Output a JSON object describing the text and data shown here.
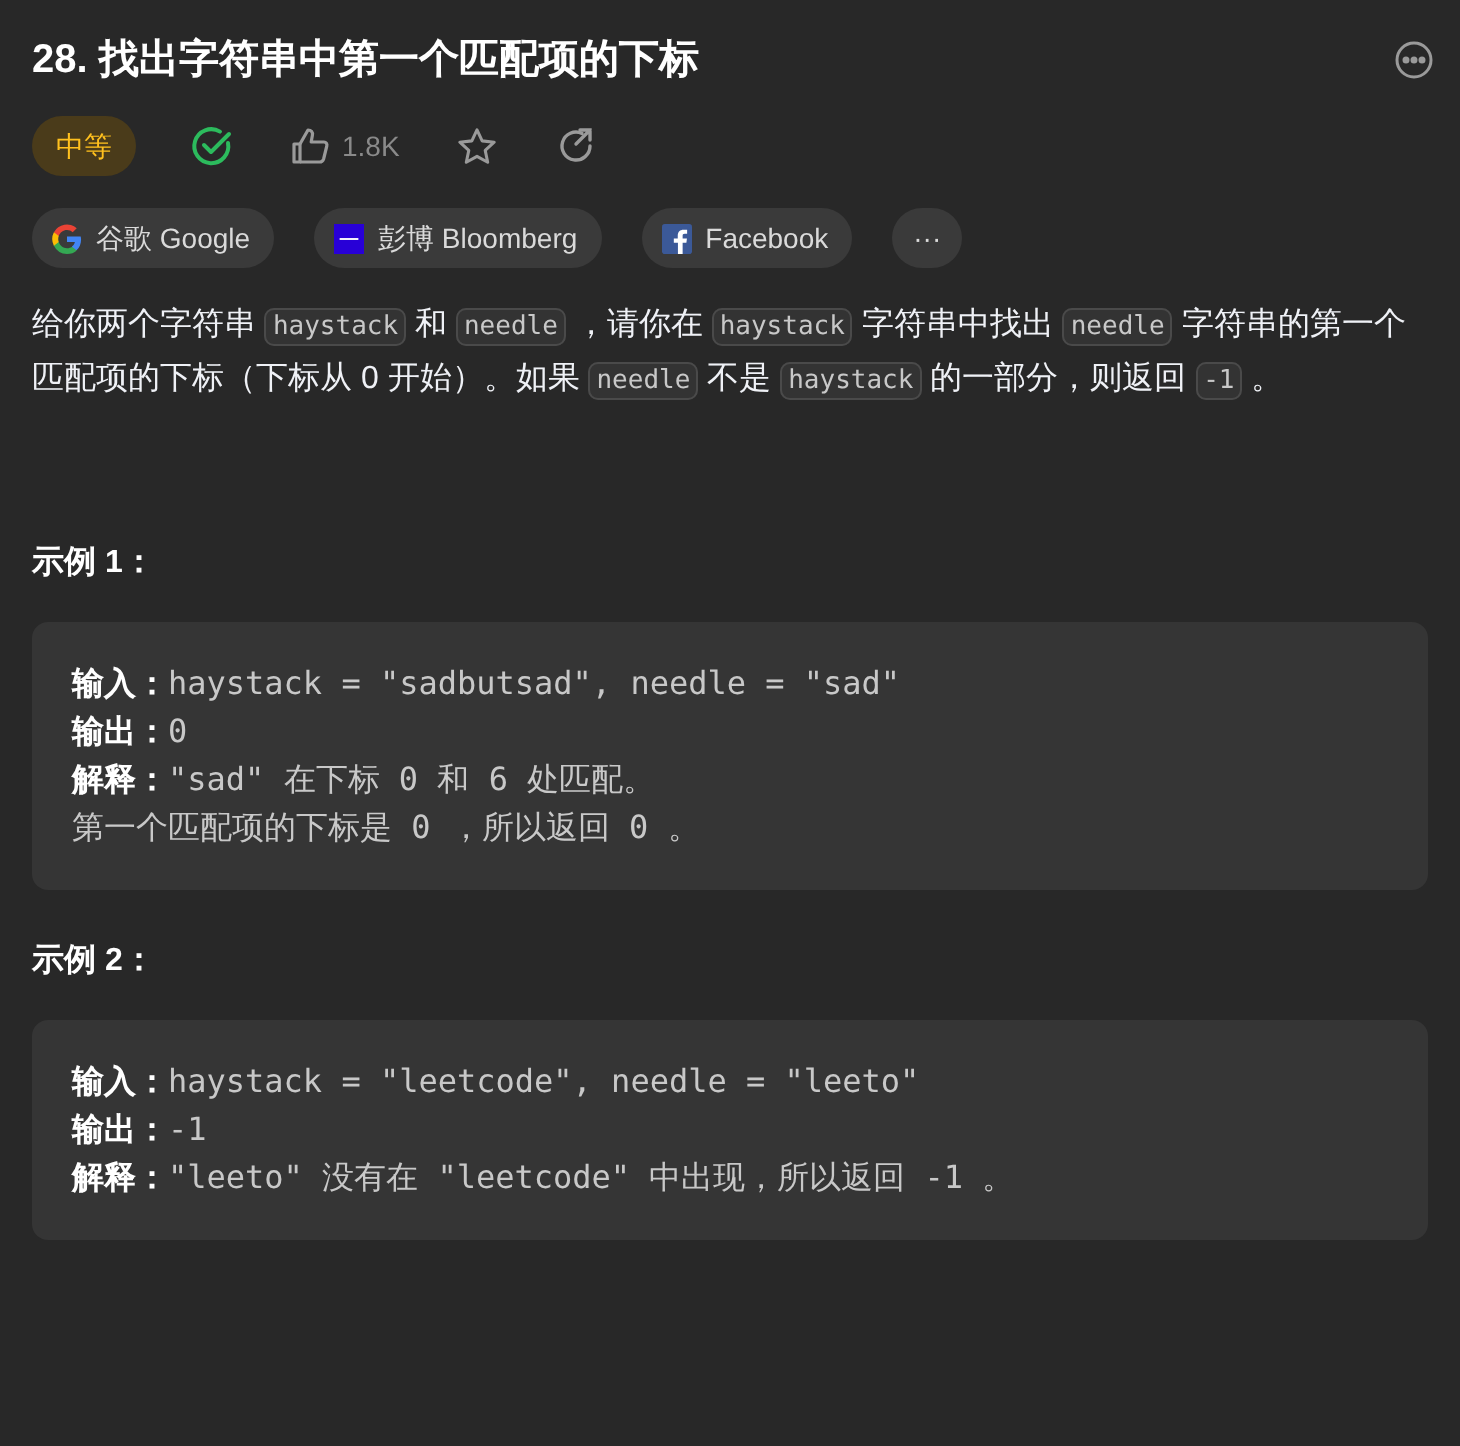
{
  "title": "28. 找出字符串中第一个匹配项的下标",
  "difficulty": {
    "label": "中等"
  },
  "solved": true,
  "likes": "1.8K",
  "companies": [
    {
      "kind": "google",
      "label": "谷歌 Google"
    },
    {
      "kind": "bloomberg",
      "label": "彭博 Bloomberg"
    },
    {
      "kind": "facebook",
      "label": "Facebook"
    }
  ],
  "more_label": "···",
  "description": [
    {
      "kind": "text",
      "text": "给你两个字符串 "
    },
    {
      "kind": "code",
      "text": "haystack"
    },
    {
      "kind": "text",
      "text": " 和 "
    },
    {
      "kind": "code",
      "text": "needle"
    },
    {
      "kind": "text",
      "text": " ，请你在 "
    },
    {
      "kind": "code",
      "text": "haystack"
    },
    {
      "kind": "text",
      "text": " 字符串中找出 "
    },
    {
      "kind": "code",
      "text": "needle"
    },
    {
      "kind": "text",
      "text": " 字符串的第一个匹配项的下标（下标从 0 开始）。如果 "
    },
    {
      "kind": "code",
      "text": "needle"
    },
    {
      "kind": "text",
      "text": " 不是 "
    },
    {
      "kind": "code",
      "text": "haystack"
    },
    {
      "kind": "text",
      "text": " 的一部分，则返回 "
    },
    {
      "kind": "code",
      "text": "-1"
    },
    {
      "kind": "text",
      "text": " 。"
    }
  ],
  "examples": [
    {
      "heading": "示例 1：",
      "lines": [
        {
          "label": "输入：",
          "value": "haystack = \"sadbutsad\", needle = \"sad\""
        },
        {
          "label": "输出：",
          "value": "0"
        },
        {
          "label": "解释：",
          "value": "\"sad\" 在下标 0 和 6 处匹配。"
        },
        {
          "value": "第一个匹配项的下标是 0 ，所以返回 0 。"
        }
      ]
    },
    {
      "heading": "示例 2：",
      "lines": [
        {
          "label": "输入：",
          "value": "haystack = \"leetcode\", needle = \"leeto\""
        },
        {
          "label": "输出：",
          "value": "-1"
        },
        {
          "label": "解释：",
          "value": "\"leeto\" 没有在 \"leetcode\" 中出现，所以返回 -1 。"
        }
      ]
    }
  ]
}
